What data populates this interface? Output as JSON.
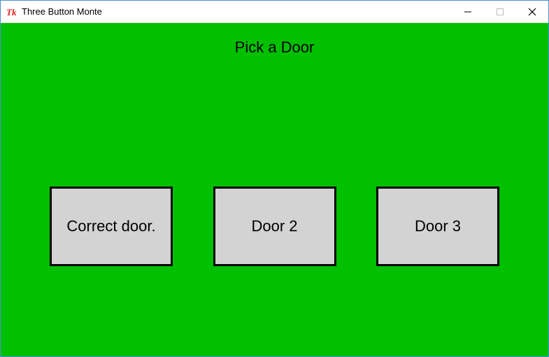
{
  "window": {
    "title": "Three Button Monte"
  },
  "prompt": "Pick a Door",
  "doors": {
    "door1": "Correct door.",
    "door2": "Door 2",
    "door3": "Door 3"
  }
}
